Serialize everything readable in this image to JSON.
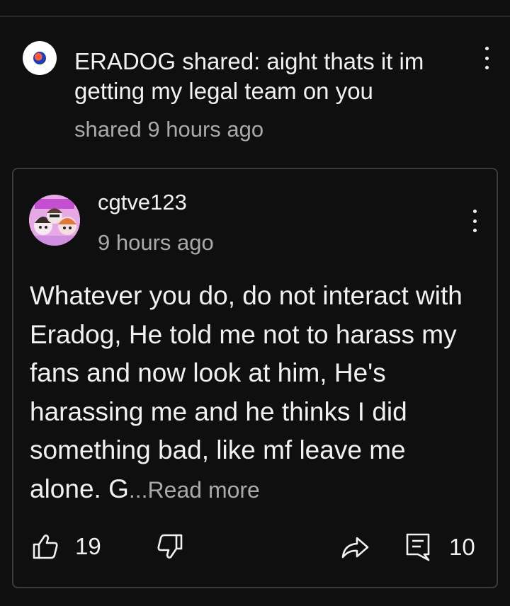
{
  "share_header": {
    "text": "ERADOG shared: aight thats it im getting my legal team on you",
    "time": "shared 9 hours ago"
  },
  "post": {
    "author": "cgtve123",
    "time": "9 hours ago",
    "body": "Whatever you do, do not interact with Eradog, He told me not to harass my fans and now look at him, He's harassing me and he thinks I did something bad, like mf leave me alone. G",
    "ellipsis": "...",
    "read_more": "Read more",
    "likes": "19",
    "comments": "10"
  },
  "icons": {
    "menu": "more-vert-icon",
    "like": "thumb-up-icon",
    "dislike": "thumb-down-icon",
    "share": "share-arrow-icon",
    "comment": "comment-icon"
  }
}
